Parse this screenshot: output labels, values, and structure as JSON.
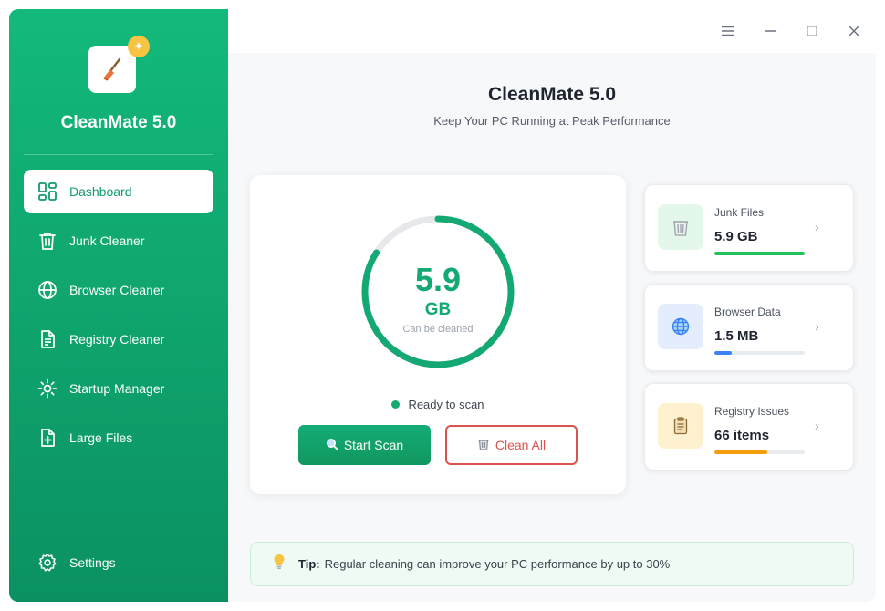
{
  "sidebar": {
    "app_title": "CleanMate 5.0",
    "items": [
      {
        "label": "Dashboard",
        "icon": "dashboard-grid-icon",
        "active": true
      },
      {
        "label": "Junk Cleaner",
        "icon": "trash-icon"
      },
      {
        "label": "Browser Cleaner",
        "icon": "globe-icon"
      },
      {
        "label": "Registry Cleaner",
        "icon": "document-icon"
      },
      {
        "label": "Startup Manager",
        "icon": "sun-icon"
      },
      {
        "label": "Large Files",
        "icon": "file-plus-icon"
      }
    ],
    "settings_label": "Settings"
  },
  "header": {
    "title": "CleanMate 5.0",
    "subtitle": "Keep Your PC Running at Peak Performance"
  },
  "scan": {
    "value": "5.9",
    "unit": "GB",
    "caption": "Can be cleaned",
    "progress_fraction": 0.84,
    "status": "Ready to scan",
    "start_label": "Start Scan",
    "clean_label": "Clean All"
  },
  "stats": [
    {
      "label": "Junk Files",
      "value": "5.9 GB",
      "fraction": 1.0,
      "color": "#22c05a",
      "icon": "recycle-bin-icon",
      "icon_bg": "#e3f7ea"
    },
    {
      "label": "Browser Data",
      "value": "1.5 MB",
      "fraction": 0.19,
      "color": "#3b82f6",
      "icon": "globe-icon",
      "icon_bg": "#e3edfb"
    },
    {
      "label": "Registry Issues",
      "value": "66 items",
      "fraction": 0.59,
      "color": "#f59e0b",
      "icon": "clipboard-icon",
      "icon_bg": "#fdf1cf"
    }
  ],
  "tip": {
    "prefix": "Tip:",
    "text": "Regular cleaning can improve your PC performance by up to 30%"
  },
  "colors": {
    "accent": "#14a872",
    "danger": "#d9534f"
  }
}
